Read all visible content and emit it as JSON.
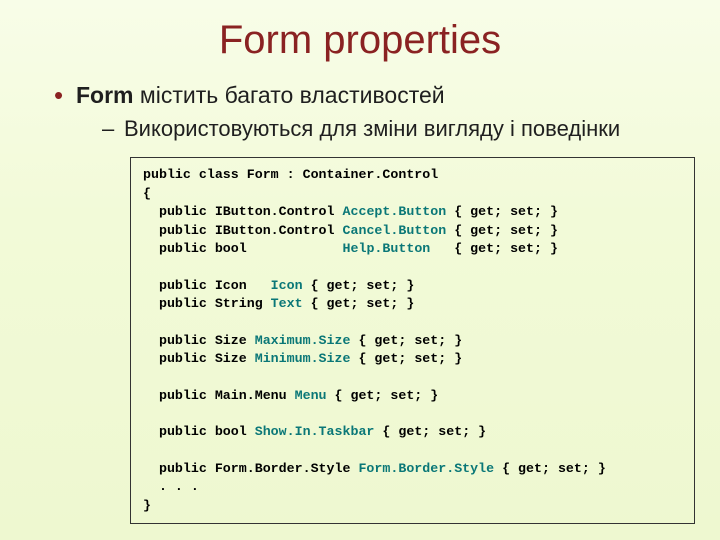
{
  "title": "Form properties",
  "bullets": {
    "main_prefix": "Form",
    "main_rest": " містить багато властивостей",
    "sub": "Використовуються для зміни вигляду і поведінки"
  },
  "code": {
    "l1_a": "public class Form : Container.Control",
    "l2_a": "{",
    "l3_a": "  public IButton.Control ",
    "l3_b": "Accept.Button",
    "l3_c": " { get; set; }",
    "l4_a": "  public IButton.Control ",
    "l4_b": "Cancel.Button",
    "l4_c": " { get; set; }",
    "l5_a": "  public bool            ",
    "l5_b": "Help.Button",
    "l5_c": "   { get; set; }",
    "blank1": "",
    "l6_a": "  public Icon   ",
    "l6_b": "Icon",
    "l6_c": " { get; set; }",
    "l7_a": "  public String ",
    "l7_b": "Text",
    "l7_c": " { get; set; }",
    "blank2": "",
    "l8_a": "  public Size ",
    "l8_b": "Maximum.Size",
    "l8_c": " { get; set; }",
    "l9_a": "  public Size ",
    "l9_b": "Minimum.Size",
    "l9_c": " { get; set; }",
    "blank3": "",
    "l10_a": "  public Main.Menu ",
    "l10_b": "Menu",
    "l10_c": " { get; set; }",
    "blank4": "",
    "l11_a": "  public bool ",
    "l11_b": "Show.In.Taskbar",
    "l11_c": " { get; set; }",
    "blank5": "",
    "l12_a": "  public Form.Border.Style ",
    "l12_b": "Form.Border.Style",
    "l12_c": " { get; set; }",
    "l13_a": "  . . .",
    "l14_a": "}"
  }
}
